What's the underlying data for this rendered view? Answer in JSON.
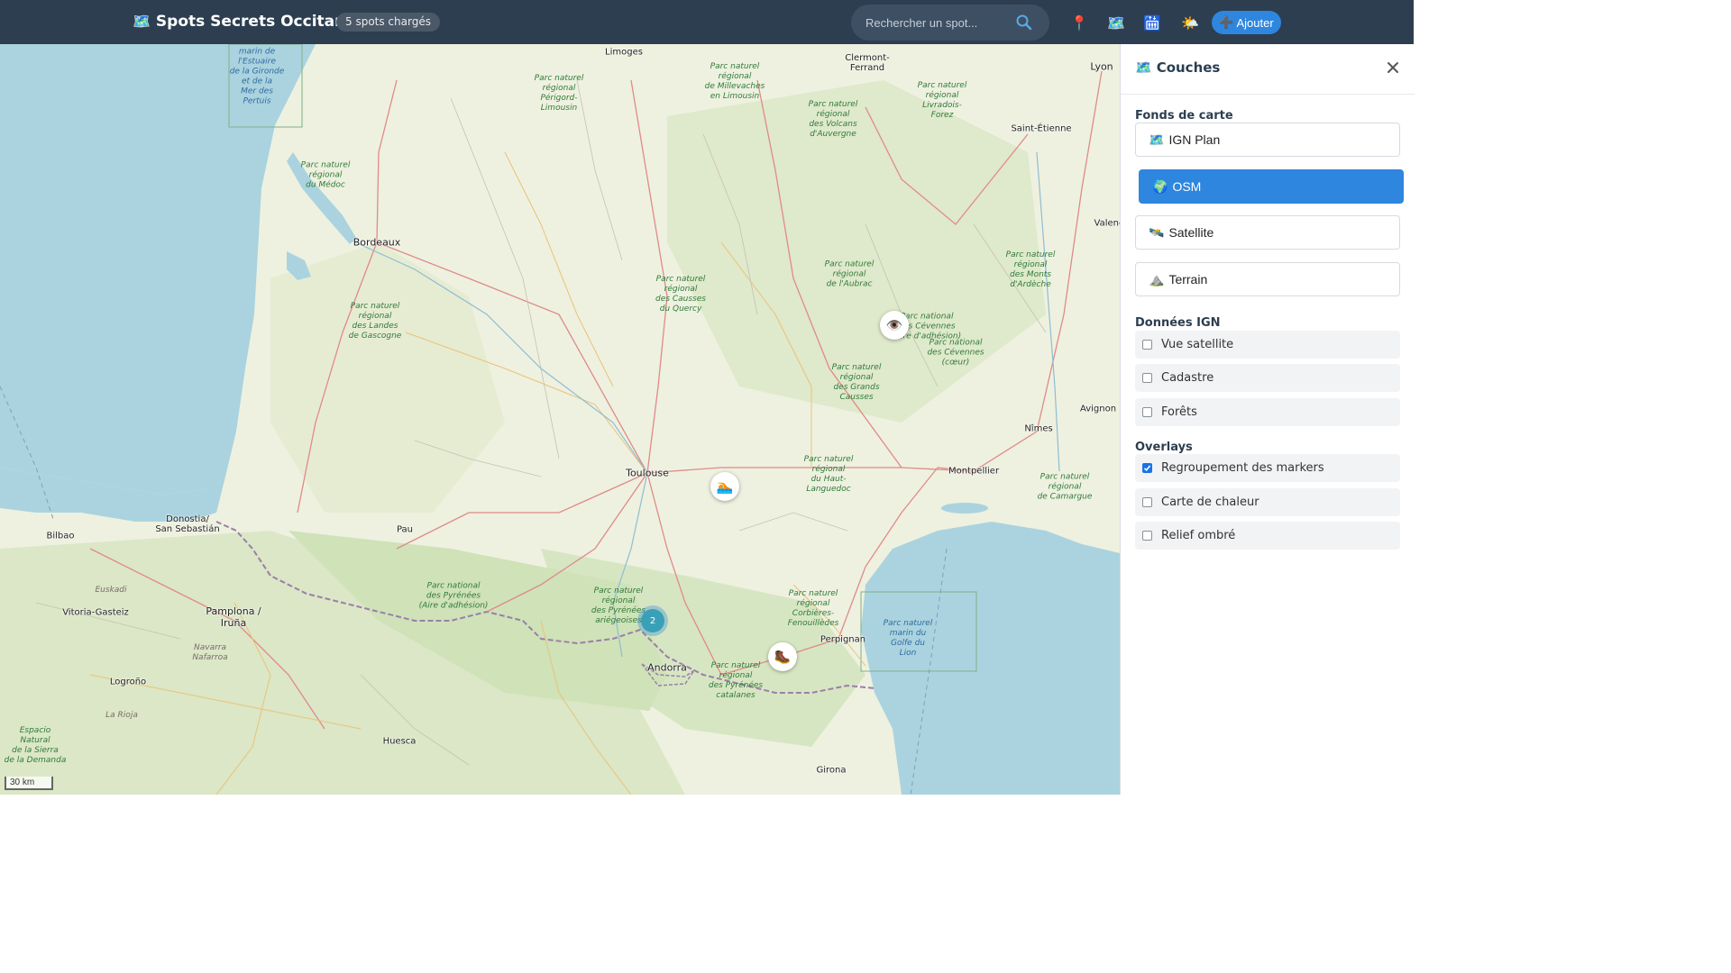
{
  "header": {
    "brand_icon": "map-icon",
    "title": "Spots Secrets Occitanie",
    "badge": "5 spots chargés",
    "search_placeholder": "Rechercher un spot...",
    "search_value": "",
    "buttons": [
      {
        "name": "locate-button",
        "icon": "pin-icon",
        "glyph": "📍"
      },
      {
        "name": "layers-button",
        "icon": "map-icon",
        "glyph": "🗺️"
      },
      {
        "name": "filter-button",
        "icon": "elevator-icon",
        "glyph": "🛗"
      },
      {
        "name": "weather-button",
        "icon": "weather-icon",
        "glyph": "🌤️"
      }
    ],
    "add_label": "Ajouter",
    "add_icon": "plus-icon",
    "accent": "#2e86de",
    "bar_color": "#2c3e50"
  },
  "map": {
    "cities": {
      "bordeaux": "Bordeaux",
      "toulouse": "Toulouse",
      "montpellier": "Montpellier",
      "nimes": "Nîmes",
      "avignon": "Avignon",
      "lyon": "Lyon",
      "saint_etienne": "Saint-Étienne",
      "clermont": "Clermont-\nFerrand",
      "limoges": "Limoges",
      "pau": "Pau",
      "donostia": "Donostia/\nSan Sebastián",
      "bilbao": "Bilbao",
      "vitoria": "Vitoria-Gasteiz",
      "pamplona": "Pamplona /\nIruña",
      "logrono": "Logroño",
      "huesca": "Huesca",
      "andorra": "Andorra",
      "perpignan": "Perpignan",
      "girona": "Girona",
      "valence": "Valenc"
    },
    "parks": {
      "medoc": "Parc naturel\nrégional\ndu Médoc",
      "landes": "Parc naturel\nrégional\ndes Landes\nde Gascogne",
      "perigord": "Parc naturel\nrégional\nPérigord-\nLimousin",
      "millevaches": "Parc naturel\nrégional\nde Millevaches\nen Limousin",
      "volcans": "Parc naturel\nrégional\ndes Volcans\nd'Auvergne",
      "livradois": "Parc naturel\nrégional\nLivradois-\nForez",
      "quercy": "Parc naturel\nrégional\ndes Causses\ndu Quercy",
      "aubrac": "Parc naturel\nrégional\nde l'Aubrac",
      "cevennes": "Parc national\ndes Cévennes\n(aire d'adhésion)",
      "cevennes_coeur": "Parc national\ndes Cévennes\n(cœur)",
      "ardeche": "Parc naturel\nrégional\ndes Monts\nd'Ardèche",
      "grands_causses": "Parc naturel\nrégional\ndes Grands\nCausses",
      "haut_languedoc": "Parc naturel\nrégional\ndu Haut-\nLanguedoc",
      "camargue": "Parc naturel\nrégional\nde Camargue",
      "pyrenees_nat": "Parc national\ndes Pyrénées\n(Aire d'adhésion)",
      "pyrenees_ariegeoises": "Parc naturel\nrégional\ndes Pyrénées\nariégeoises",
      "corbieres": "Parc naturel\nrégional\nCorbières-\nFenouillèdes",
      "pyrenees_catalanes": "Parc naturel\nrégional\ndes Pyrénées\ncatalanes",
      "golfe_lion": "Parc naturel\nmarin du\nGolfe du\nLion",
      "gironde": "Parc naturel\nmarin de\nl'Estuaire\nde la Gironde\net de la\nMer des\nPertuis",
      "sierra": "Espacio\nNatural\nde la Sierra\nde la Demanda"
    },
    "regions": {
      "euskadi": "Euskadi",
      "navarra": "Navarra\nNafarroa",
      "rioja": "La Rioja"
    },
    "markers": [
      {
        "name": "spot-marker-viewpoint",
        "icon": "eye-icon",
        "glyph": "👁️"
      },
      {
        "name": "spot-marker-swimming",
        "icon": "swimmer-icon",
        "glyph": "🏊"
      },
      {
        "name": "spot-marker-hiking",
        "icon": "boot-icon",
        "glyph": "🥾"
      }
    ],
    "cluster_count": "2",
    "scale_label": "30 km"
  },
  "panel": {
    "title_icon": "map-icon",
    "title": "Couches",
    "close_icon": "close-icon",
    "base_title": "Fonds de carte",
    "base_layers": [
      {
        "label": "IGN Plan",
        "icon": "map-icon",
        "glyph": "🗺️",
        "active": false
      },
      {
        "label": "OSM",
        "icon": "globe-icon",
        "glyph": "🌍",
        "active": true
      },
      {
        "label": "Satellite",
        "icon": "satellite-icon",
        "glyph": "🛰️",
        "active": false
      },
      {
        "label": "Terrain",
        "icon": "mountain-icon",
        "glyph": "⛰️",
        "active": false
      }
    ],
    "ign_title": "Données IGN",
    "ign_layers": [
      {
        "label": "Vue satellite",
        "checked": false
      },
      {
        "label": "Cadastre",
        "checked": false
      },
      {
        "label": "Forêts",
        "checked": false
      }
    ],
    "overlays_title": "Overlays",
    "overlays": [
      {
        "label": "Regroupement des markers",
        "checked": true
      },
      {
        "label": "Carte de chaleur",
        "checked": false
      },
      {
        "label": "Relief ombré",
        "checked": false
      }
    ]
  }
}
